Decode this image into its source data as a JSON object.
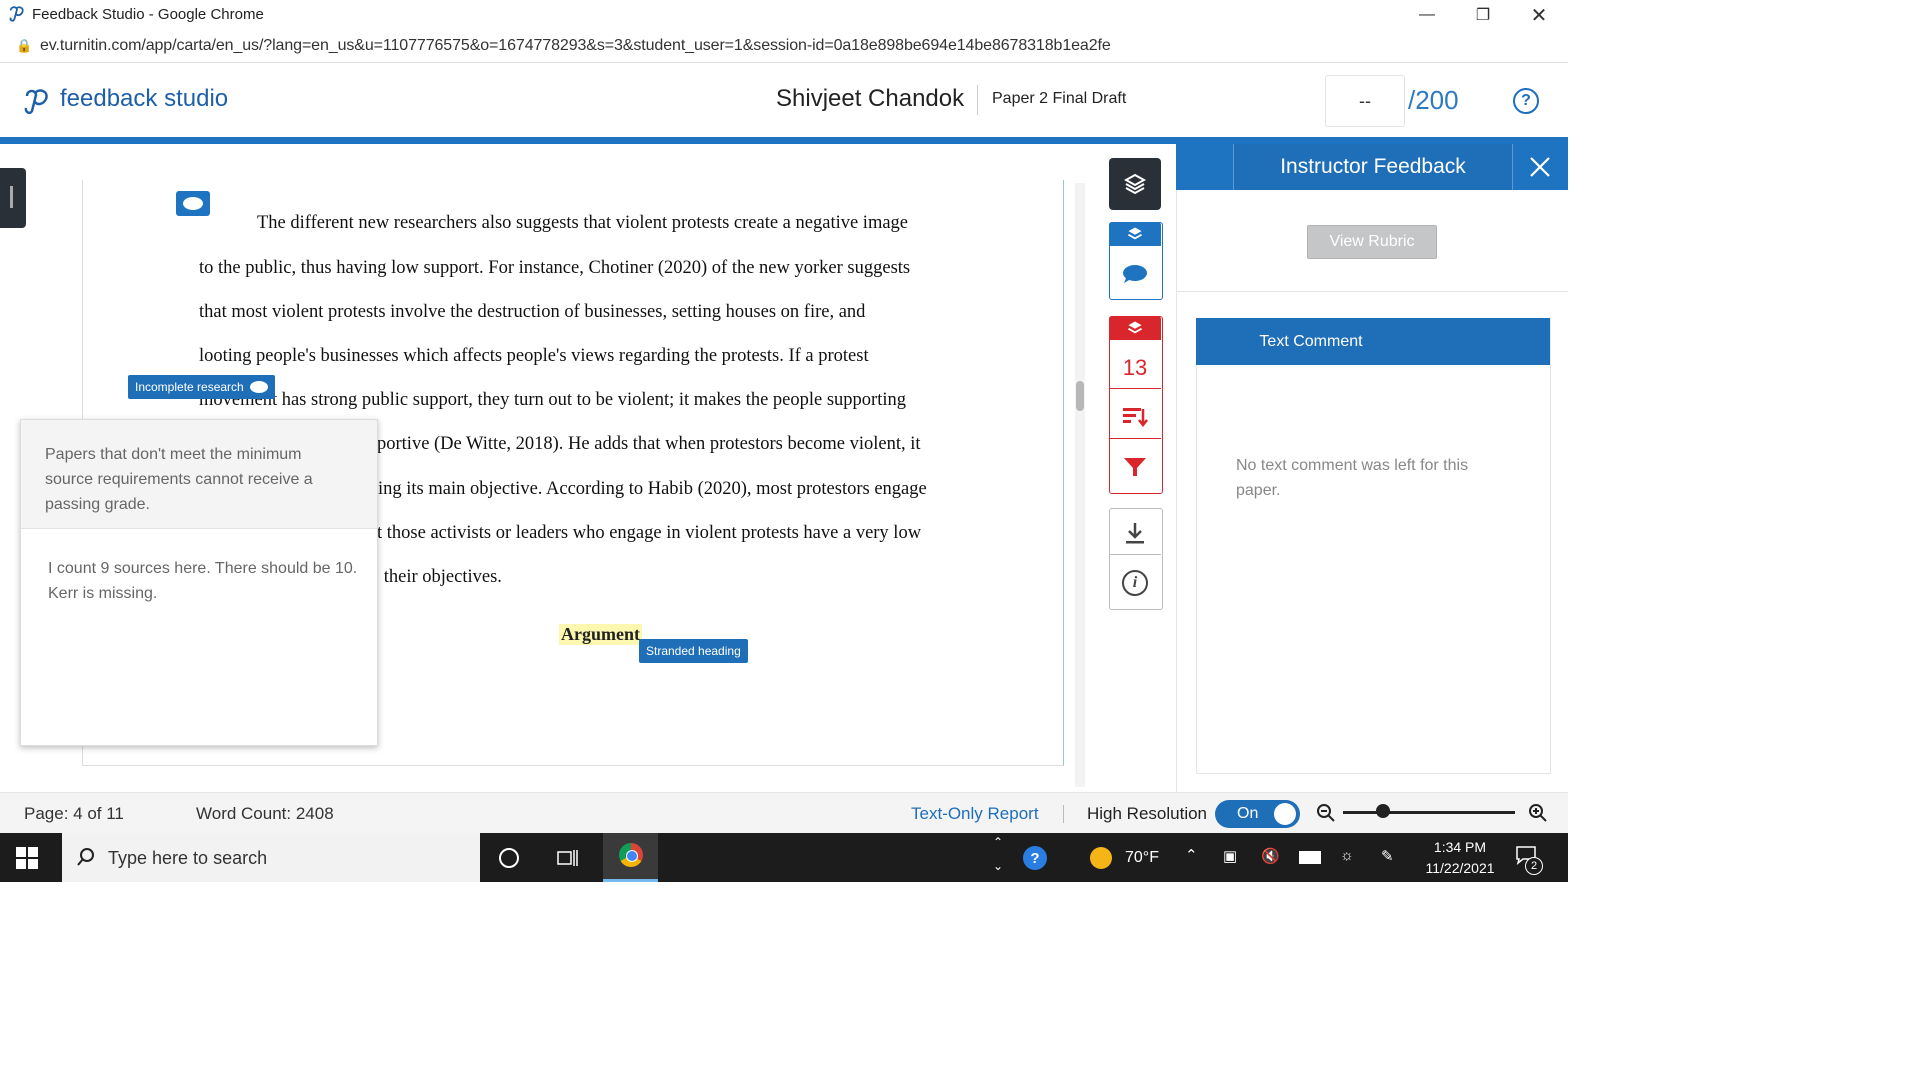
{
  "browser": {
    "window_title": "Feedback Studio - Google Chrome",
    "url": "ev.turnitin.com/app/carta/en_us/?lang=en_us&u=1107776575&o=1674778293&s=3&student_user=1&session-id=0a18e898be694e14be8678318b1ea2fe"
  },
  "header": {
    "brand": "feedback studio",
    "student_name": "Shivjeet Chandok",
    "paper_title": "Paper 2 Final Draft",
    "grade_value": "--",
    "grade_out_of": "/200",
    "help_label": "?"
  },
  "document": {
    "lines": [
      "The different new researchers also suggests that violent protests create a negative image",
      "to the public, thus having low support. For instance, Chotiner (2020) of the new yorker suggests",
      "that most violent protests involve the destruction of businesses, setting houses on fire, and",
      "looting people's businesses which affects people's views regarding the protests. If a protest",
      "movement has strong public support, they turn out to be violent; it makes the people supporting",
      "portive (De Witte, 2018). He adds that when protestors become violent, it",
      "ing its main objective. According to Habib (2020), most protestors engage",
      "t those activists or leaders who engage in violent protests have a very low",
      "; their objectives."
    ],
    "heading": "Argument",
    "tags": {
      "incomplete_research": "Incomplete research",
      "stranded_heading": "Stranded heading"
    },
    "popup": {
      "qm_text": "Papers that don't meet the minimum source requirements cannot receive a passing grade.",
      "comment_text": "I count 9 sources here. There should be 10. Kerr is missing."
    }
  },
  "toolbar": {
    "flag_count": "13",
    "info_label": "i"
  },
  "right_panel": {
    "title": "Instructor Feedback",
    "view_rubric": "View Rubric",
    "text_comment_title": "Text Comment",
    "no_comment": "No text comment was left for this paper."
  },
  "footer": {
    "page": "Page: 4 of 11",
    "word_count": "Word Count: 2408",
    "text_only_report": "Text-Only Report",
    "high_resolution": "High Resolution",
    "toggle_state": "On",
    "zoom_fraction": 0.23
  },
  "taskbar": {
    "search_placeholder": "Type here to search",
    "temperature": "70°F",
    "time": "1:34 PM",
    "date": "11/22/2021",
    "notification_count": "2"
  },
  "colors": {
    "accent": "#1f74c1",
    "flag_red": "#d9262c",
    "dark": "#2a3038",
    "highlight": "#fdf8b0"
  }
}
